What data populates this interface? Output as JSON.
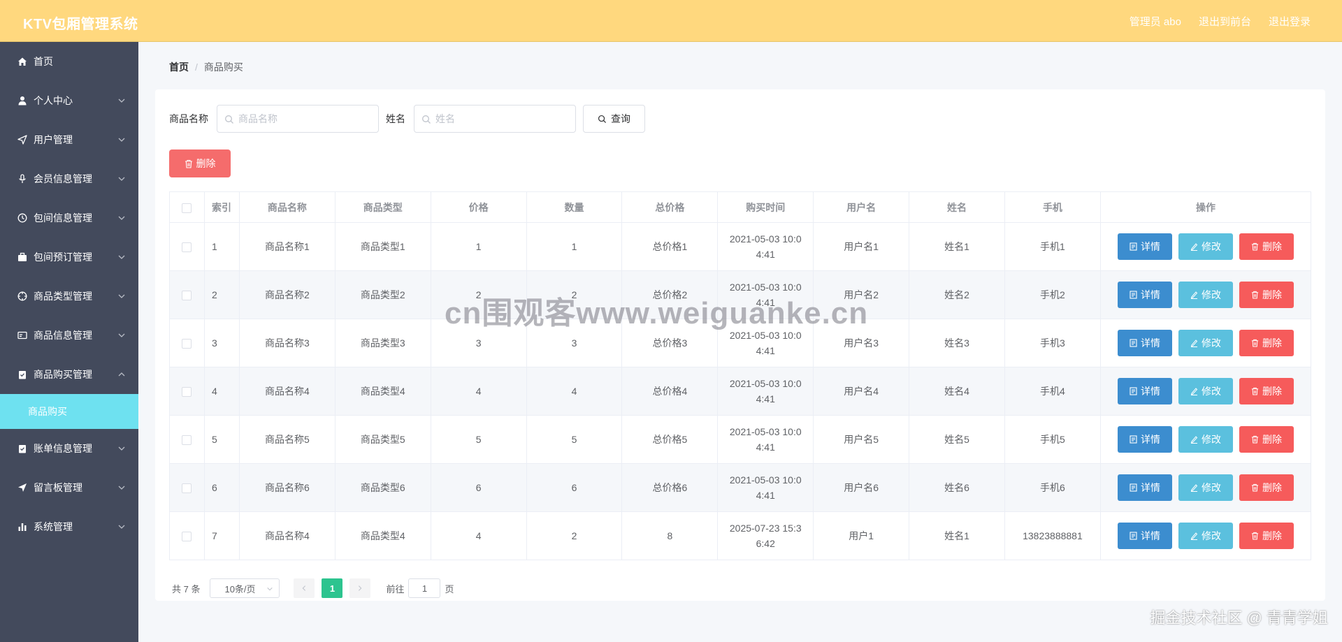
{
  "header": {
    "brand": "KTV包厢管理系统",
    "admin": "管理员 abo",
    "frontend": "退出到前台",
    "logout": "退出登录"
  },
  "sidebar": {
    "items": [
      {
        "label": "首页",
        "icon": "home-icon",
        "chevron": false
      },
      {
        "label": "个人中心",
        "icon": "user-icon",
        "chevron": "down"
      },
      {
        "label": "用户管理",
        "icon": "send-icon",
        "chevron": "down"
      },
      {
        "label": "会员信息管理",
        "icon": "microphone-icon",
        "chevron": "down"
      },
      {
        "label": "包间信息管理",
        "icon": "clock-icon",
        "chevron": "down"
      },
      {
        "label": "包间预订管理",
        "icon": "briefcase-icon",
        "chevron": "down"
      },
      {
        "label": "商品类型管理",
        "icon": "target-icon",
        "chevron": "down"
      },
      {
        "label": "商品信息管理",
        "icon": "card-icon",
        "chevron": "down"
      },
      {
        "label": "商品购买管理",
        "icon": "clipboard-icon",
        "chevron": "up"
      },
      {
        "label": "账单信息管理",
        "icon": "clipboard-check-icon",
        "chevron": "down"
      },
      {
        "label": "留言板管理",
        "icon": "paper-plane-icon",
        "chevron": "down"
      },
      {
        "label": "系统管理",
        "icon": "bar-chart-icon",
        "chevron": "down"
      }
    ],
    "active_sub": "商品购买"
  },
  "breadcrumb": {
    "home": "首页",
    "sep": "/",
    "current": "商品购买"
  },
  "search": {
    "name_label": "商品名称",
    "name_placeholder": "商品名称",
    "person_label": "姓名",
    "person_placeholder": "姓名",
    "query_label": "查询"
  },
  "batch_delete_label": "删除",
  "table": {
    "headers": [
      "索引",
      "商品名称",
      "商品类型",
      "价格",
      "数量",
      "总价格",
      "购买时间",
      "用户名",
      "姓名",
      "手机",
      "操作"
    ],
    "rows": [
      {
        "index": "1",
        "name": "商品名称1",
        "type": "商品类型1",
        "price": "1",
        "qty": "1",
        "total": "总价格1",
        "time1": "2021-05-03 10:0",
        "time2": "4:41",
        "user": "用户名1",
        "person": "姓名1",
        "phone": "手机1"
      },
      {
        "index": "2",
        "name": "商品名称2",
        "type": "商品类型2",
        "price": "2",
        "qty": "2",
        "total": "总价格2",
        "time1": "2021-05-03 10:0",
        "time2": "4:41",
        "user": "用户名2",
        "person": "姓名2",
        "phone": "手机2"
      },
      {
        "index": "3",
        "name": "商品名称3",
        "type": "商品类型3",
        "price": "3",
        "qty": "3",
        "total": "总价格3",
        "time1": "2021-05-03 10:0",
        "time2": "4:41",
        "user": "用户名3",
        "person": "姓名3",
        "phone": "手机3"
      },
      {
        "index": "4",
        "name": "商品名称4",
        "type": "商品类型4",
        "price": "4",
        "qty": "4",
        "total": "总价格4",
        "time1": "2021-05-03 10:0",
        "time2": "4:41",
        "user": "用户名4",
        "person": "姓名4",
        "phone": "手机4"
      },
      {
        "index": "5",
        "name": "商品名称5",
        "type": "商品类型5",
        "price": "5",
        "qty": "5",
        "total": "总价格5",
        "time1": "2021-05-03 10:0",
        "time2": "4:41",
        "user": "用户名5",
        "person": "姓名5",
        "phone": "手机5"
      },
      {
        "index": "6",
        "name": "商品名称6",
        "type": "商品类型6",
        "price": "6",
        "qty": "6",
        "total": "总价格6",
        "time1": "2021-05-03 10:0",
        "time2": "4:41",
        "user": "用户名6",
        "person": "姓名6",
        "phone": "手机6"
      },
      {
        "index": "7",
        "name": "商品名称4",
        "type": "商品类型4",
        "price": "4",
        "qty": "2",
        "total": "8",
        "time1": "2025-07-23 15:3",
        "time2": "6:42",
        "user": "用户1",
        "person": "姓名1",
        "phone": "13823888881"
      }
    ],
    "actions": {
      "detail": "详情",
      "edit": "修改",
      "delete": "删除"
    }
  },
  "pagination": {
    "total": "共 7 条",
    "page_size": "10条/页",
    "current_page": "1",
    "goto_label": "前往",
    "goto_value": "1",
    "page_suffix": "页"
  },
  "watermarks": {
    "center": "cn围观客www.weiguanke.cn",
    "corner": "掘金技术社区 @ 青青学姐"
  },
  "colors": {
    "header_bg": "#ffd87e",
    "sidebar_bg": "#434a5c",
    "active_sub_bg": "#6ee1f0",
    "danger": "#f56c6c",
    "primary": "#3c8dcf",
    "info": "#5bc0de",
    "page_active": "#2dc48f"
  }
}
